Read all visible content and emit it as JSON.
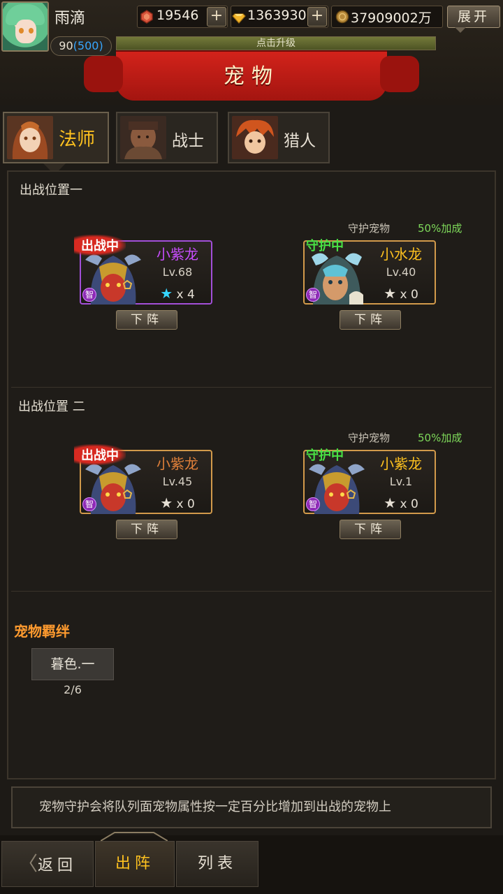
{
  "player": {
    "name": "雨滴",
    "level": "90",
    "level_max": "(500)"
  },
  "resources": {
    "gems": "19546",
    "diamonds": "1363930",
    "gold": "37909002万"
  },
  "header": {
    "expand_label": "展开",
    "xp_hint": "点击升级",
    "title": "宠物"
  },
  "class_tabs": [
    {
      "label": "法师",
      "active": true
    },
    {
      "label": "战士",
      "active": false
    },
    {
      "label": "猎人",
      "active": false
    }
  ],
  "slots": [
    {
      "title": "出战位置一",
      "guard_label": "守护宠物",
      "bonus_label": "50%加成",
      "battle_pet": {
        "status": "出战中",
        "name": "小紫龙",
        "level": "Lv.68",
        "stars": "x 4",
        "attr": "智",
        "name_color": "#c84dff",
        "star_color": "#36d7ff"
      },
      "guard_pet": {
        "status": "守护中",
        "name": "小水龙",
        "level": "Lv.40",
        "stars": "x 0",
        "attr": "智",
        "name_color": "#ffc21f",
        "star_color": "#e6e0d5"
      },
      "dismiss_label": "下阵"
    },
    {
      "title": "出战位置 二",
      "guard_label": "守护宠物",
      "bonus_label": "50%加成",
      "battle_pet": {
        "status": "出战中",
        "name": "小紫龙",
        "level": "Lv.45",
        "stars": "x 0",
        "attr": "智",
        "name_color": "#e0803a",
        "star_color": "#e6e0d5"
      },
      "guard_pet": {
        "status": "守护中",
        "name": "小紫龙",
        "level": "Lv.1",
        "stars": "x 0",
        "attr": "智",
        "name_color": "#ffc21f",
        "star_color": "#e6e0d5"
      },
      "dismiss_label": "下阵"
    }
  ],
  "bond": {
    "title": "宠物羁绊",
    "button_label": "暮色.一",
    "progress": "2/6"
  },
  "info_text": "宠物守护会将队列面宠物属性按一定百分比增加到出战的宠物上",
  "nav": {
    "back": "返回",
    "deploy": "出阵",
    "list": "列表"
  },
  "icons": {
    "gem": "red-gem-icon",
    "diamond": "gold-diamond-icon",
    "coin": "gold-coin-icon",
    "star": "star-icon",
    "back_arrow": "chevron-left-icon"
  },
  "colors": {
    "accent": "#ffc21f",
    "battle_tag": "#d72a21",
    "guard_tag": "#48e044",
    "bonus": "#7ed95a",
    "bond_title": "#ff9b2f",
    "banner_red": "#c81e17"
  }
}
